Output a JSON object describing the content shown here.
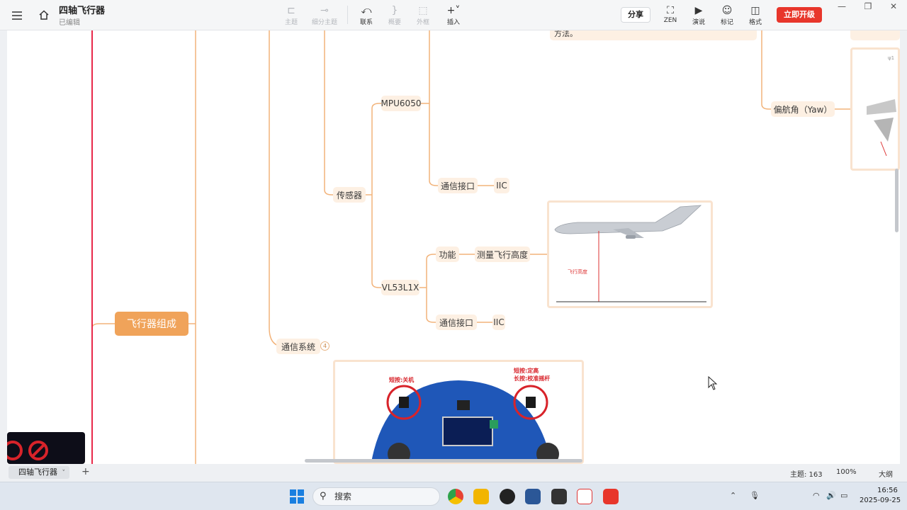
{
  "header": {
    "title": "四轴飞行器",
    "status": "已编辑"
  },
  "toolbar": {
    "topic": "主题",
    "subtopic": "细分主题",
    "relation": "联系",
    "summary": "概要",
    "boundary": "外框",
    "insert": "插入",
    "share": "分享",
    "zen": "ZEN",
    "present": "演说",
    "marker": "标记",
    "format": "格式",
    "upgrade": "立即开级"
  },
  "mindmap": {
    "note_text": "方法。",
    "yaw": "偏航角（Yaw）",
    "mpu": "MPU6050",
    "comm_interface_1": "通信接口",
    "iic_1": "IIC",
    "sensor": "传感器",
    "function": "功能",
    "measure_height": "测量飞行高度",
    "vl53": "VL53L1X",
    "comm_interface_2": "通信接口",
    "iic_2": "IIC",
    "main_topic": "飞行器组成",
    "comm_system": "通信系统",
    "comm_system_count": "4",
    "plane_label": "飞行高度",
    "board_label_left": "短按:关机",
    "board_label_right_1": "短按:定高",
    "board_label_right_2": "长按:校准摇杆"
  },
  "tabs": {
    "sheet": "四轴飞行器",
    "add": "+",
    "topic_count": "主题: 163",
    "zoom": "100%",
    "outline": "大纲"
  },
  "taskbar": {
    "search": "搜索",
    "time": "16:56",
    "date": "2025-09-25"
  },
  "colors": {
    "accent_red": "#e8362b",
    "branch_orange": "#f0a35a",
    "node_bg": "#fdf0e3",
    "main_line": "#e8284a"
  }
}
